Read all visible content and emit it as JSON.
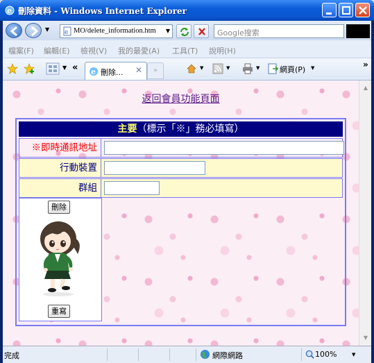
{
  "window": {
    "title": "刪除資料 - Windows Internet Explorer"
  },
  "addressbar": {
    "url": "MO/delete_information.htm",
    "search_placeholder": "Google搜索"
  },
  "menu": {
    "items": [
      "檔案(F)",
      "編輯(E)",
      "檢視(V)",
      "我的最愛(A)",
      "工具(T)",
      "說明(H)"
    ]
  },
  "tabbar": {
    "tab_label": "刪除...",
    "page_label": "網頁(P)"
  },
  "content": {
    "back_link": "返回會員功能頁面",
    "header_main": "主要",
    "header_note": "（標示「※」務必填寫）",
    "rows": [
      {
        "label": "※即時通訊地址",
        "required": true
      },
      {
        "label": "行動裝置",
        "required": false
      },
      {
        "label": "群組",
        "required": false
      }
    ],
    "delete_button": "刪除",
    "reset_button": "重寫"
  },
  "statusbar": {
    "status": "完成",
    "zone": "網際網路",
    "zoom": "100%"
  }
}
